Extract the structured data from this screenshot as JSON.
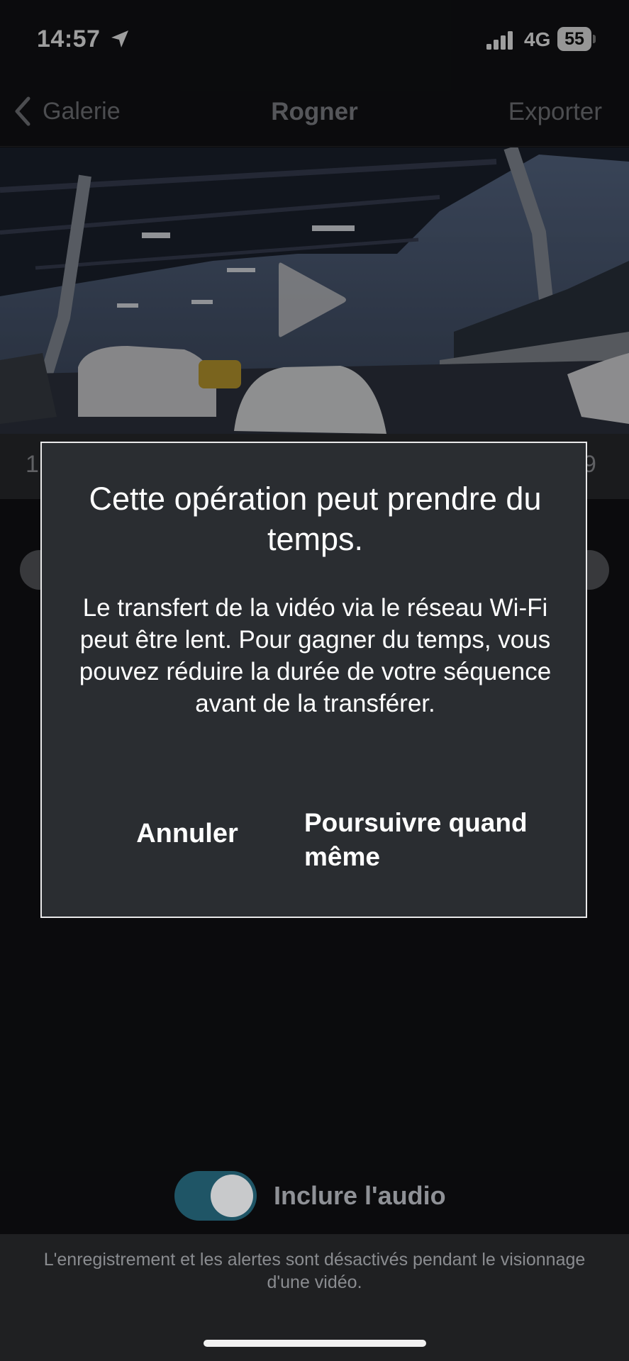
{
  "status_bar": {
    "time": "14:57",
    "network": "4G",
    "battery": "55"
  },
  "nav": {
    "back_label": "Galerie",
    "title": "Rogner",
    "export_label": "Exporter"
  },
  "timeline": {
    "start_partial": "1",
    "end_partial": "9"
  },
  "dialog": {
    "title": "Cette opération peut prendre du temps.",
    "message": "Le transfert de la vidéo via le réseau Wi-Fi peut être lent. Pour gagner du temps, vous pouvez réduire la durée de votre séquence avant de la transférer.",
    "cancel_label": "Annuler",
    "continue_label": "Poursuivre quand même"
  },
  "audio": {
    "label": "Inclure l'audio",
    "enabled": true
  },
  "footer": {
    "notice": "L'enregistrement et les alertes sont désactivés pendant le visionnage d'une vidéo."
  },
  "colors": {
    "background": "#121315",
    "dialog": "#2a2d31",
    "toggle_on": "#1f5566"
  }
}
